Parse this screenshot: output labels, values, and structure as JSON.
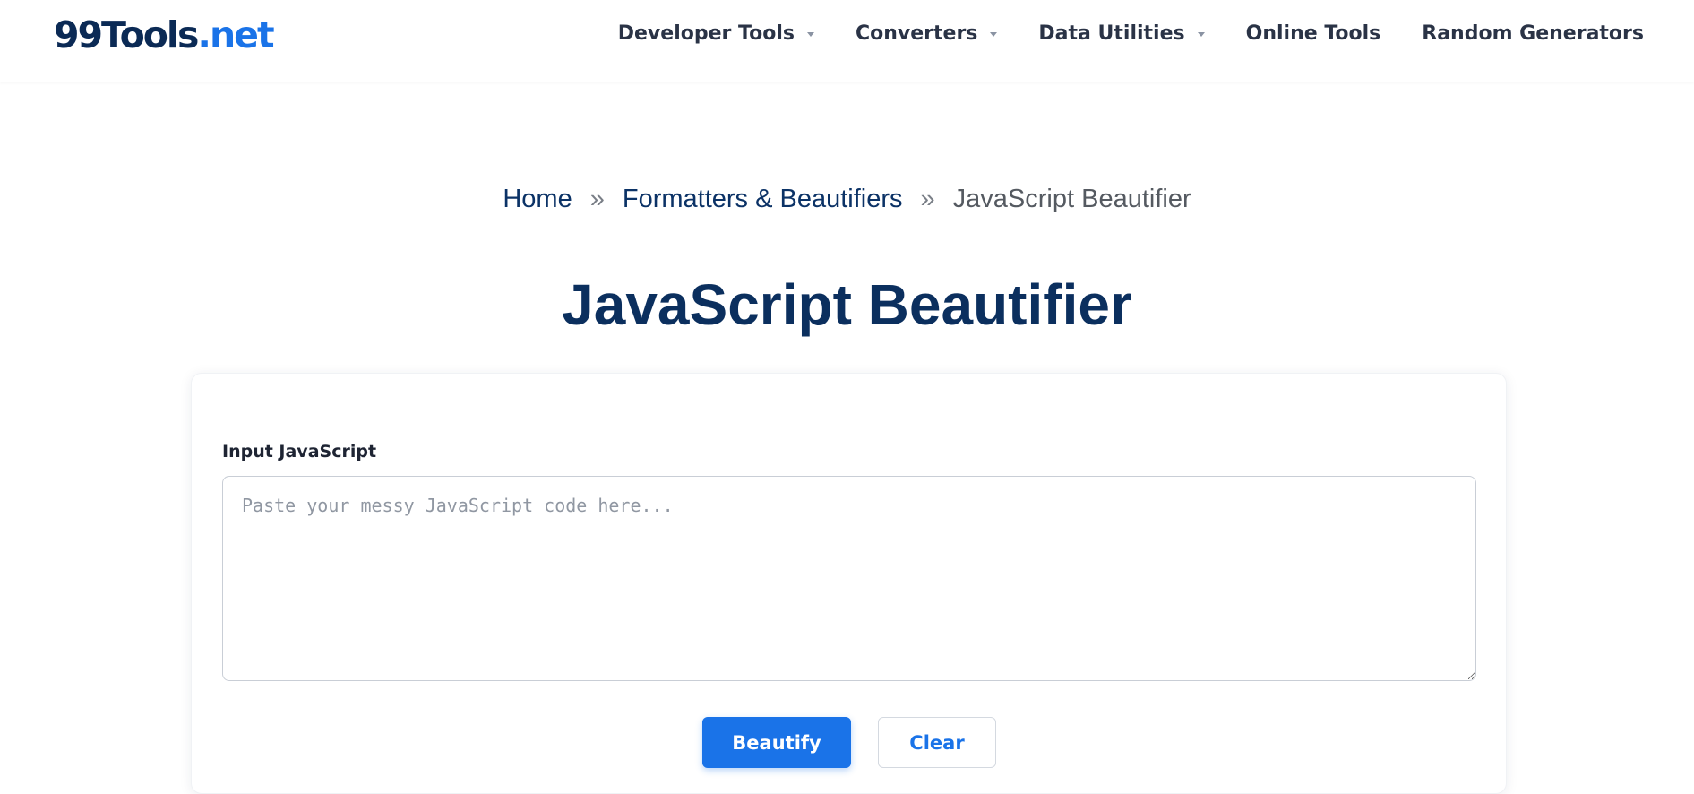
{
  "header": {
    "logo_main": "99Tools",
    "logo_tld": ".net",
    "nav": [
      {
        "label": "Developer Tools",
        "has_dropdown": true
      },
      {
        "label": "Converters",
        "has_dropdown": true
      },
      {
        "label": "Data Utilities",
        "has_dropdown": true
      },
      {
        "label": "Online Tools",
        "has_dropdown": false
      },
      {
        "label": "Random Generators",
        "has_dropdown": false
      }
    ]
  },
  "breadcrumb": {
    "home": "Home",
    "separator": "»",
    "category": "Formatters & Beautifiers",
    "current": "JavaScript Beautifier"
  },
  "page": {
    "title": "JavaScript Beautifier"
  },
  "form": {
    "input_label": "Input JavaScript",
    "input_value": "",
    "input_placeholder": "Paste your messy JavaScript code here...",
    "beautify_label": "Beautify",
    "clear_label": "Clear"
  },
  "colors": {
    "brand_dark": "#0b2a55",
    "accent": "#1a73e8",
    "title": "#0b2f5e"
  }
}
